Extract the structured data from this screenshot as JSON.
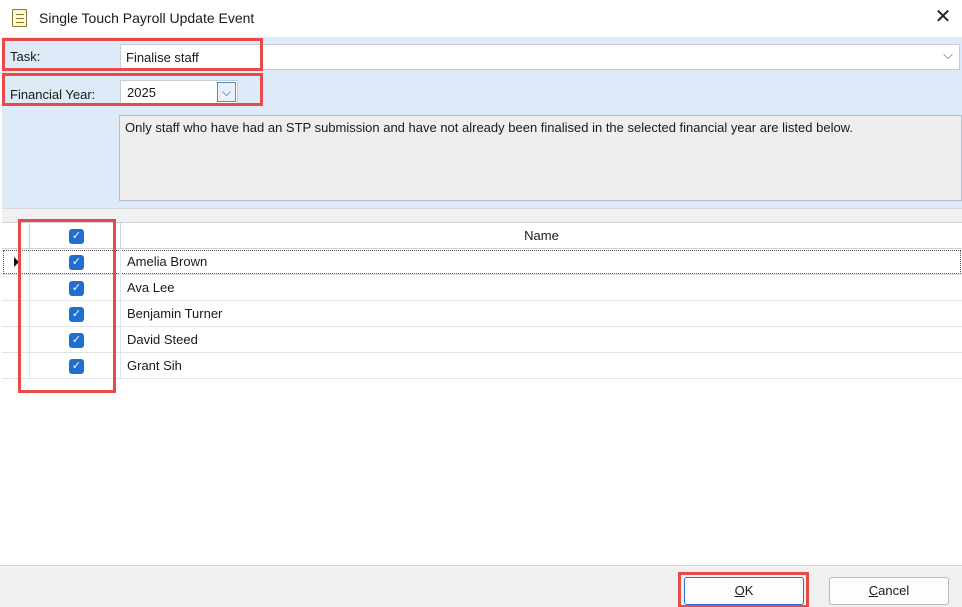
{
  "window": {
    "title": "Single Touch Payroll Update Event",
    "icon": "document-icon",
    "close_glyph": "✕"
  },
  "form": {
    "task_label": "Task:",
    "task_value": "Finalise staff",
    "task_chevron": "⌵",
    "year_label": "Financial Year:",
    "year_value": "2025",
    "year_chevron": "⌵",
    "info_text": "Only staff who have had an STP submission and have not already been finalised in the selected financial year are listed below."
  },
  "grid": {
    "header_name": "Name",
    "header_checked": true,
    "current_row": 0,
    "rows": [
      {
        "name": "Amelia Brown",
        "checked": true
      },
      {
        "name": "Ava Lee",
        "checked": true
      },
      {
        "name": "Benjamin Turner",
        "checked": true
      },
      {
        "name": "David Steed",
        "checked": true
      },
      {
        "name": "Grant Sih",
        "checked": true
      }
    ],
    "check_glyph": "✓"
  },
  "footer": {
    "ok_mnemonic": "O",
    "ok_rest": "K",
    "cancel_mnemonic": "C",
    "cancel_rest": "ancel"
  },
  "colors": {
    "highlight": "#e84a4a",
    "form_background": "#ddeaf7",
    "checkbox": "#1f6fd1"
  }
}
